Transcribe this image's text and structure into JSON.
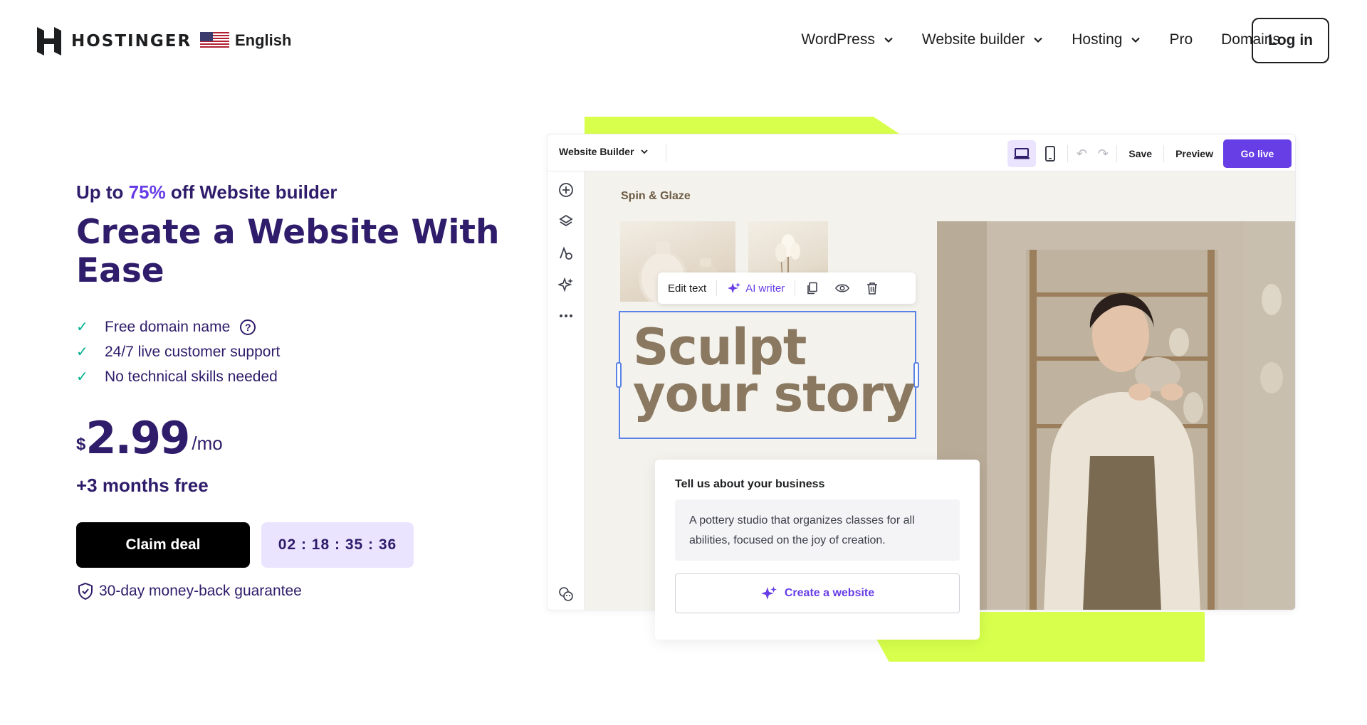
{
  "header": {
    "brand": "HOSTINGER",
    "language": "English",
    "nav": [
      {
        "label": "WordPress",
        "has_dropdown": true
      },
      {
        "label": "Website builder",
        "has_dropdown": true
      },
      {
        "label": "Hosting",
        "has_dropdown": true
      },
      {
        "label": "Pro",
        "has_dropdown": false
      },
      {
        "label": "Domains",
        "has_dropdown": false
      }
    ],
    "login_label": "Log in"
  },
  "hero": {
    "promo_prefix": "Up to ",
    "promo_percent": "75%",
    "promo_suffix": " off Website builder",
    "title": "Create a Website With Ease",
    "features": [
      "Free domain name",
      "24/7 live customer support",
      "No technical skills needed"
    ],
    "help_icon_glyph": "?",
    "price_currency": "$",
    "price_amount": "2.99",
    "price_period": "/mo",
    "bonus": "+3 months free",
    "claim_label": "Claim deal",
    "timer": "02 : 18 : 35 : 36",
    "guarantee": "30-day money-back guarantee"
  },
  "builder": {
    "selector_label": "Website Builder",
    "save_label": "Save",
    "preview_label": "Preview",
    "golive_label": "Go live",
    "site_name": "Spin & Glaze",
    "edit_text_label": "Edit text",
    "ai_writer_label": "AI writer",
    "headline_line1": "Sculpt",
    "headline_line2": "your story",
    "ai_card_title": "Tell us about your business",
    "ai_card_text": "A pottery studio that organizes classes for all abilities, focused on the joy of creation.",
    "ai_create_label": "Create a website"
  },
  "colors": {
    "brand_purple": "#673de6",
    "dark_navy": "#2f1c6a",
    "accent_lime": "#d7ff4b",
    "check_green": "#00b090",
    "timer_bg": "#ebe4ff"
  },
  "icons": {
    "sidebar": [
      "add-icon",
      "layers-icon",
      "typography-icon",
      "ai-sparkle-icon",
      "more-icon",
      "help-face-icon"
    ],
    "toolbar": [
      "desktop-icon",
      "mobile-icon",
      "undo-icon",
      "redo-icon"
    ],
    "edit_bar": [
      "copy-icon",
      "eye-icon",
      "trash-icon"
    ]
  }
}
